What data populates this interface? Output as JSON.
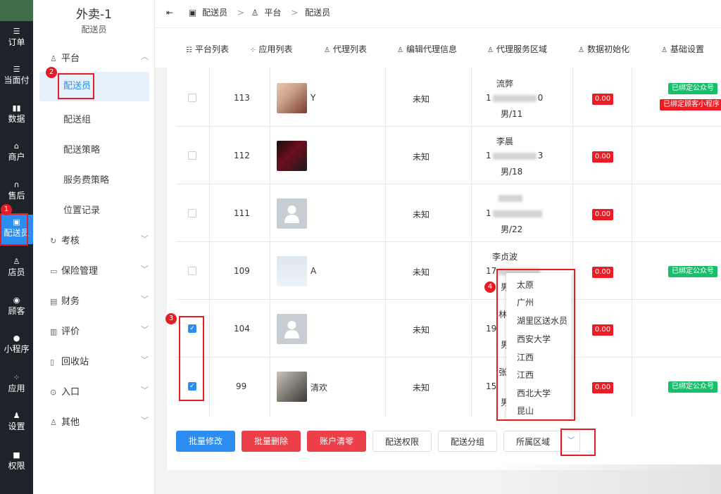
{
  "iconbar": {
    "items": [
      {
        "label": "订单",
        "icon": "list-icon"
      },
      {
        "label": "当面付",
        "icon": "list-icon"
      },
      {
        "label": "数据",
        "icon": "bar-chart-icon"
      },
      {
        "label": "商户",
        "icon": "store-icon"
      },
      {
        "label": "售后",
        "icon": "headset-icon"
      },
      {
        "label": "配送员",
        "icon": "delivery-truck-icon"
      },
      {
        "label": "店员",
        "icon": "user-group-icon"
      },
      {
        "label": "顾客",
        "icon": "customer-icon"
      },
      {
        "label": "小程序",
        "icon": "wechat-icon"
      },
      {
        "label": "应用",
        "icon": "apps-icon"
      },
      {
        "label": "设置",
        "icon": "settings-user-icon"
      },
      {
        "label": "权限",
        "icon": "lock-icon"
      }
    ]
  },
  "subbar": {
    "title": "外卖-1",
    "subtitle": "配送员",
    "platform_label": "平台",
    "items": [
      "配送员",
      "配送组",
      "配送策略",
      "服务费策略",
      "位置记录"
    ],
    "groups": [
      "考核",
      "保险管理",
      "财务",
      "评价",
      "回收站",
      "入口",
      "其他"
    ]
  },
  "breadcrumb": {
    "items": [
      "配送员",
      "平台",
      "配送员"
    ]
  },
  "tabs": [
    "平台列表",
    "应用列表",
    "代理列表",
    "编辑代理信息",
    "代理服务区域",
    "数据初始化",
    "基础设置"
  ],
  "rows": [
    {
      "id": "113",
      "nickname": "Y",
      "status": "未知",
      "name": "流弊",
      "phone_start": "1",
      "phone_end": "0",
      "gender_id": "男/11",
      "amount": "0.00",
      "tags": [
        "已绑定公众号",
        "已绑定顾客小程序"
      ],
      "checked": false
    },
    {
      "id": "112",
      "nickname": "",
      "status": "未知",
      "name": "李晨",
      "phone_start": "1",
      "phone_end": "3",
      "gender_id": "男/18",
      "amount": "0.00",
      "tags": [],
      "checked": false
    },
    {
      "id": "111",
      "nickname": "",
      "status": "未知",
      "name": "",
      "phone_start": "1",
      "phone_end": "",
      "gender_id": "男/22",
      "amount": "0.00",
      "tags": [],
      "checked": false
    },
    {
      "id": "109",
      "nickname": "A",
      "status": "未知",
      "name": "李贞波",
      "phone_start": "17",
      "phone_end": "",
      "gender_id": "男",
      "amount": "0.00",
      "tags": [
        "已绑定公众号"
      ],
      "checked": false
    },
    {
      "id": "104",
      "nickname": "",
      "status": "未知",
      "name": "林",
      "phone_start": "19",
      "phone_end": "",
      "gender_id": "男",
      "amount": "0.00",
      "tags": [],
      "checked": true
    },
    {
      "id": "99",
      "nickname": "清欢",
      "status": "未知",
      "name": "张",
      "phone_start": "15",
      "phone_end": "",
      "gender_id": "男",
      "amount": "0.00",
      "tags": [
        "已绑定公众号"
      ],
      "checked": true
    }
  ],
  "buttons": {
    "batch_edit": "批量修改",
    "batch_delete": "批量删除",
    "clear_account": "账户清零",
    "delivery_permission": "配送权限",
    "delivery_group": "配送分组",
    "region": "所属区域"
  },
  "dropdown": {
    "options": [
      "太原",
      "广州",
      "湖里区送水员",
      "西安大学",
      "江西",
      "江西",
      "西北大学",
      "昆山"
    ]
  },
  "markers": [
    "1",
    "2",
    "3",
    "4"
  ],
  "colors": {
    "primary": "#2d8cf0",
    "danger": "#ed1b24",
    "success": "#19be6b",
    "sidebar": "#1e2329"
  }
}
